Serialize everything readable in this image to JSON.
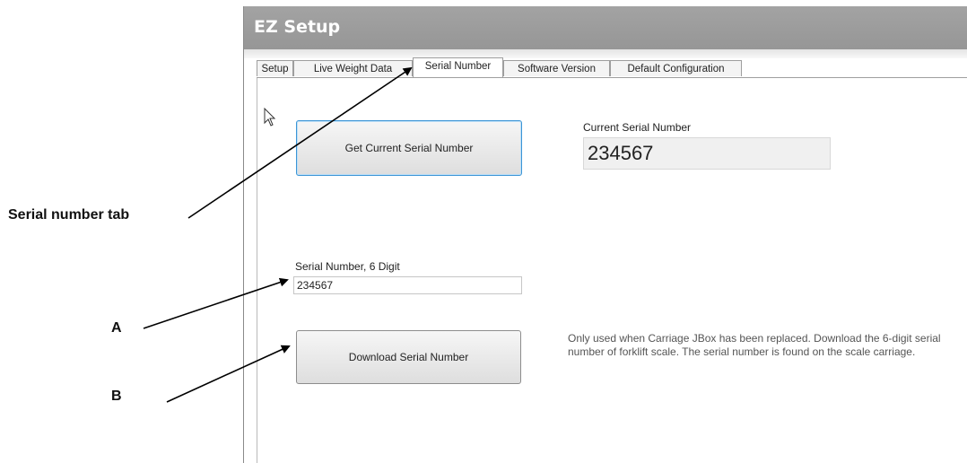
{
  "window": {
    "title": "EZ Setup"
  },
  "tabs": [
    {
      "label": "Setup",
      "active": false
    },
    {
      "label": "Live Weight Data",
      "active": false
    },
    {
      "label": "Serial Number",
      "active": true
    },
    {
      "label": "Software Version",
      "active": false
    },
    {
      "label": "Default Configuration",
      "active": false
    }
  ],
  "serial_panel": {
    "get_button_label": "Get Current Serial Number",
    "current_label": "Current Serial Number",
    "current_value": "234567",
    "input_label": "Serial Number, 6 Digit",
    "input_value": "234567",
    "download_button_label": "Download Serial Number",
    "download_note": "Only used when Carriage JBox has been replaced.  Download the 6-digit serial number of forklift scale. The serial number is found on the scale carriage."
  },
  "callouts": {
    "tab_label": "Serial number tab",
    "a_label": "A",
    "b_label": "B"
  },
  "colors": {
    "titlebar": "#9d9d9d",
    "focus_border": "#3c95d6"
  },
  "icons": {
    "cursor": "mouse-pointer-icon"
  }
}
